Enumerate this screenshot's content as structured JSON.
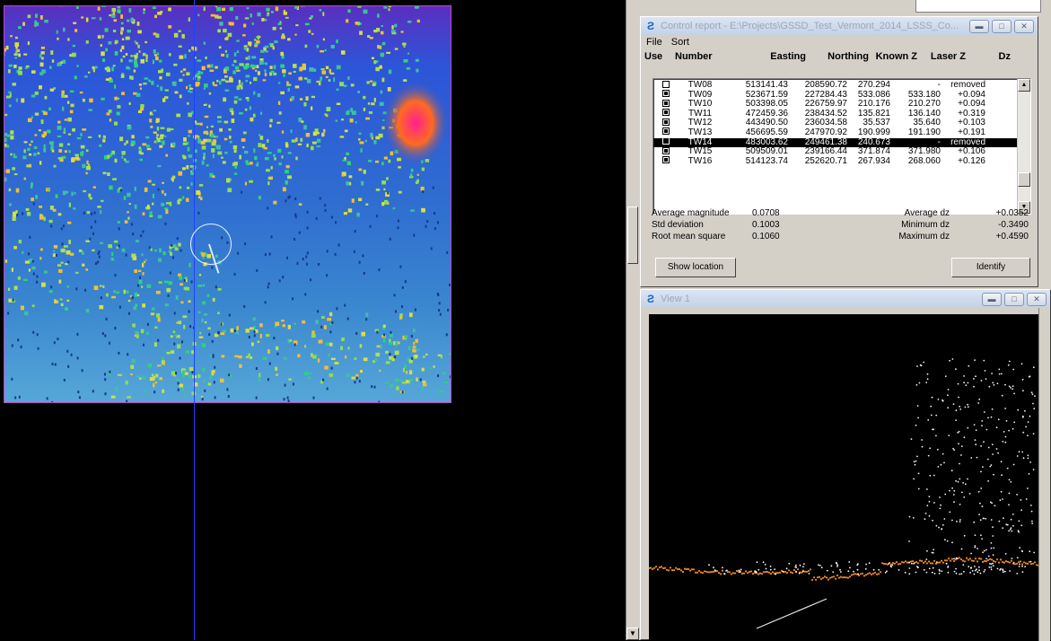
{
  "report_window": {
    "title": "Control report - E:\\Projects\\GSSD_Test_Vermont_2014_LSSS_Co...",
    "menu": [
      "File",
      "Sort"
    ],
    "columns": [
      "Use",
      "Number",
      "Easting",
      "Northing",
      "Known Z",
      "Laser Z",
      "Dz"
    ],
    "rows": [
      {
        "use": false,
        "number": "TW08",
        "easting": "513141.43",
        "northing": "208590.72",
        "known_z": "270.294",
        "laser_z": "-",
        "dz": "removed"
      },
      {
        "use": true,
        "number": "TW09",
        "easting": "523671.59",
        "northing": "227284.43",
        "known_z": "533.086",
        "laser_z": "533.180",
        "dz": "+0.094"
      },
      {
        "use": true,
        "number": "TW10",
        "easting": "503398.05",
        "northing": "226759.97",
        "known_z": "210.176",
        "laser_z": "210.270",
        "dz": "+0.094"
      },
      {
        "use": true,
        "number": "TW11",
        "easting": "472459.36",
        "northing": "238434.52",
        "known_z": "135.821",
        "laser_z": "136.140",
        "dz": "+0.319"
      },
      {
        "use": true,
        "number": "TW12",
        "easting": "443490.50",
        "northing": "236034.58",
        "known_z": "35.537",
        "laser_z": "35.640",
        "dz": "+0.103"
      },
      {
        "use": true,
        "number": "TW13",
        "easting": "456695.59",
        "northing": "247970.92",
        "known_z": "190.999",
        "laser_z": "191.190",
        "dz": "+0.191"
      },
      {
        "use": false,
        "number": "TW14",
        "easting": "483003.62",
        "northing": "249461.38",
        "known_z": "240.673",
        "laser_z": "-",
        "dz": "removed",
        "selected": true
      },
      {
        "use": true,
        "number": "TW15",
        "easting": "509509.01",
        "northing": "239166.44",
        "known_z": "371.874",
        "laser_z": "371.980",
        "dz": "+0.106"
      },
      {
        "use": true,
        "number": "TW16",
        "easting": "514123.74",
        "northing": "252620.71",
        "known_z": "267.934",
        "laser_z": "268.060",
        "dz": "+0.126"
      }
    ],
    "stats": {
      "average_magnitude_label": "Average magnitude",
      "average_magnitude": "0.0708",
      "std_deviation_label": "Std deviation",
      "std_deviation": "0.1003",
      "rms_label": "Root mean square",
      "rms": "0.1060",
      "average_dz_label": "Average dz",
      "average_dz": "+0.0352",
      "minimum_dz_label": "Minimum dz",
      "minimum_dz": "-0.3490",
      "maximum_dz_label": "Maximum dz",
      "maximum_dz": "+0.4590"
    },
    "show_location_label": "Show location",
    "identify_label": "Identify"
  },
  "view_window": {
    "title": "View 1"
  },
  "icons": {
    "app": "microstation-icon",
    "minimize": "minimize-icon",
    "maximize": "maximize-icon",
    "close": "close-icon"
  }
}
